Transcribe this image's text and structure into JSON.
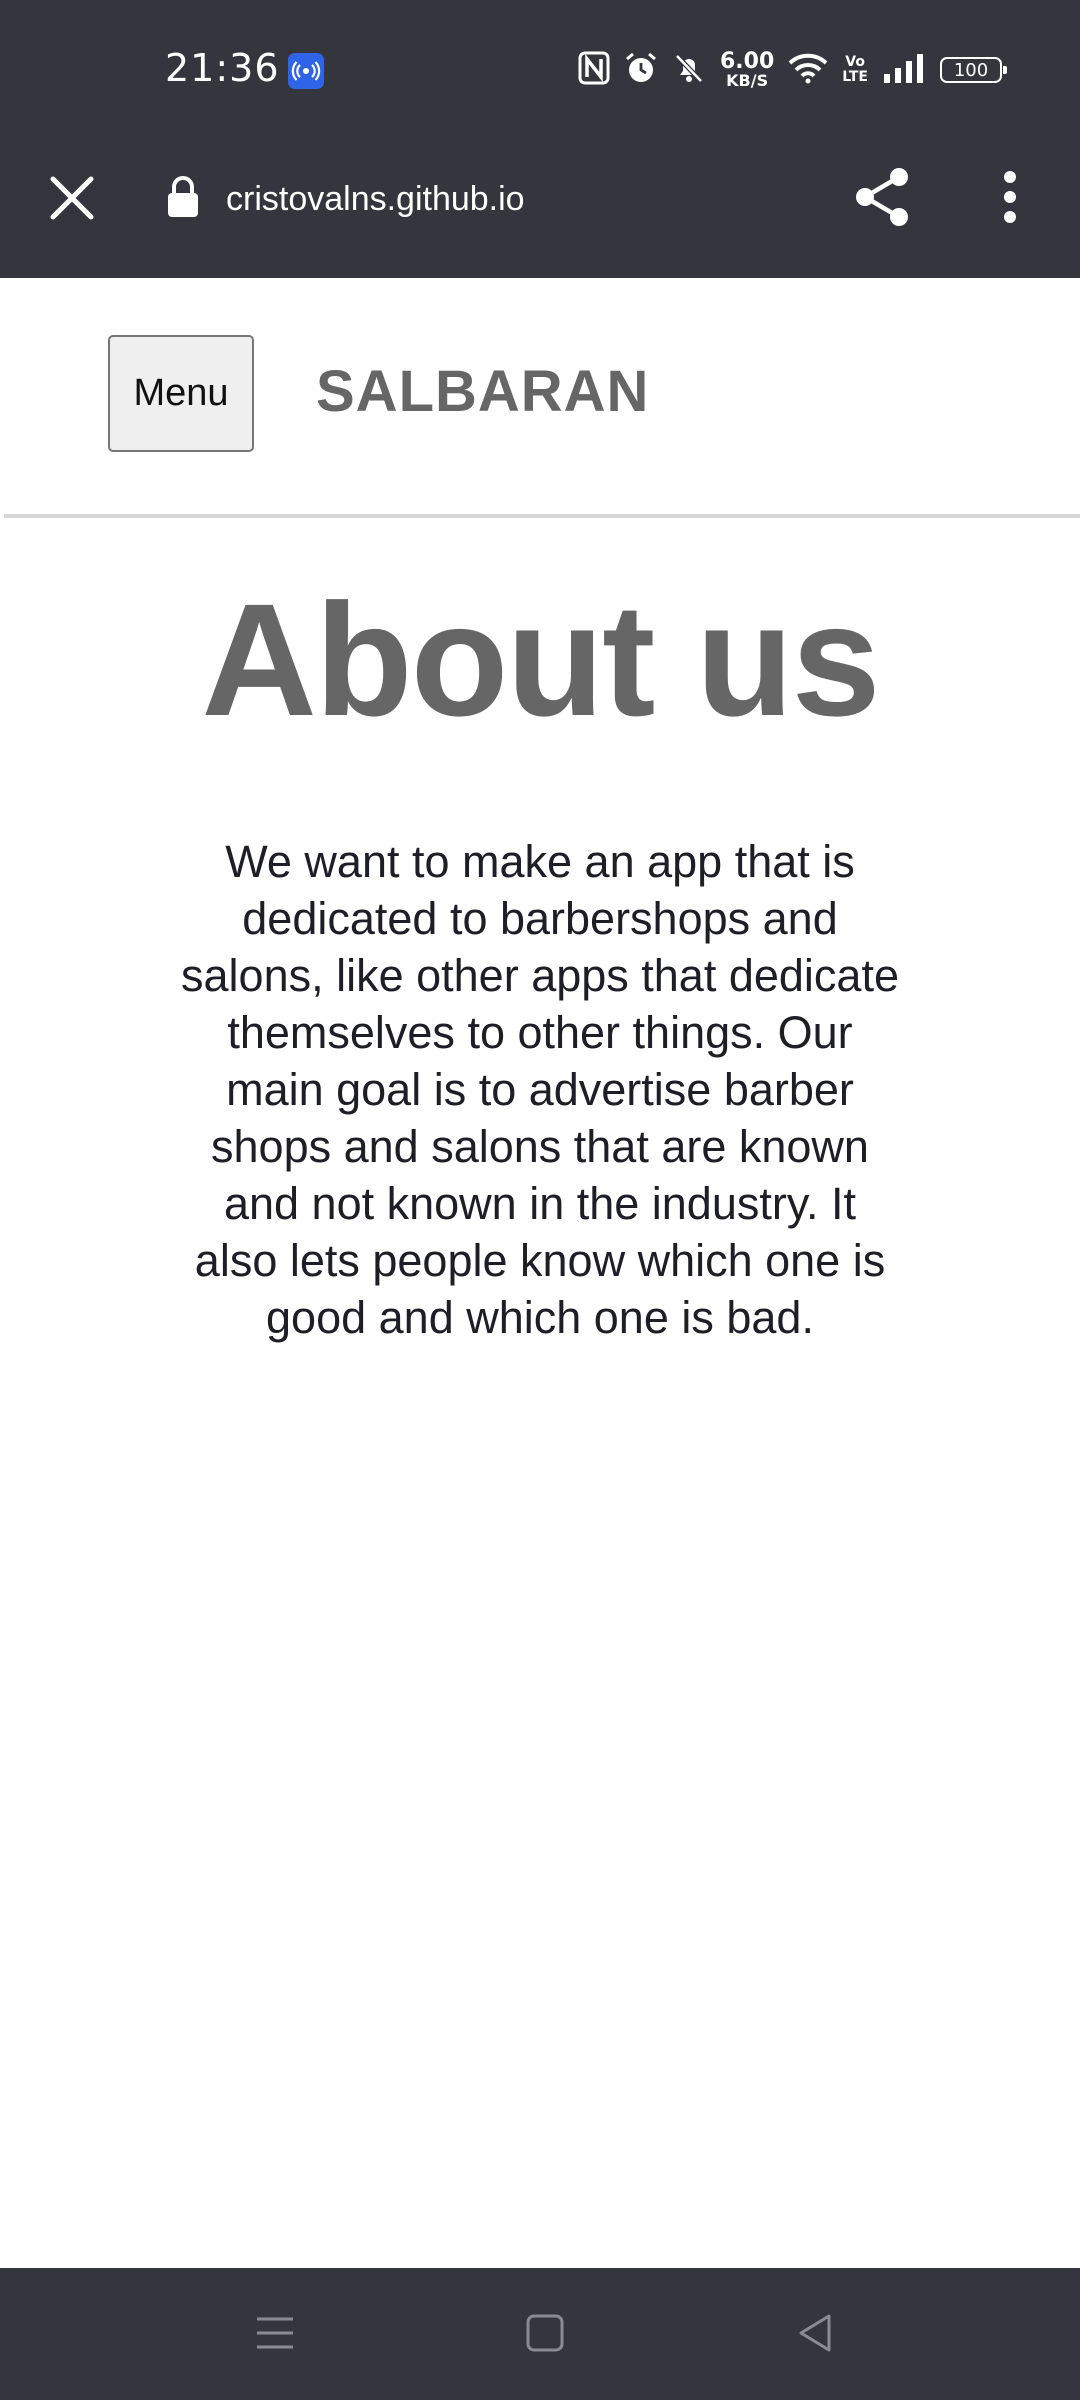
{
  "status_bar": {
    "time": "21:36",
    "network_speed_value": "6.00",
    "network_speed_unit": "KB/S",
    "volte_top": "Vo",
    "volte_bottom": "LTE",
    "battery_level": "100",
    "icons": [
      "hotspot-icon",
      "nfc-icon",
      "alarm-icon",
      "mute-icon",
      "wifi-icon",
      "volte-icon",
      "signal-icon",
      "battery-icon"
    ]
  },
  "browser": {
    "url": "cristovalns.github.io",
    "icons": [
      "close-icon",
      "lock-icon",
      "share-icon",
      "more-vertical-icon"
    ]
  },
  "site_header": {
    "menu_label": "Menu",
    "brand": "SALBARAN"
  },
  "main": {
    "title": "About us",
    "paragraph": "We want to make an app that is dedicated to barbershops and salons, like other apps that dedicate themselves to other things. Our main goal is to advertise barber shops and salons that are known and not known in the industry. It also lets people know which one is good and which one is bad."
  },
  "nav_bar": {
    "icons": [
      "recent-apps-icon",
      "home-icon",
      "back-icon"
    ]
  },
  "colors": {
    "chrome": "#35363d",
    "heading_gray": "#666666",
    "body_text": "#1e1e26",
    "hotspot_blue": "#2f63e8",
    "button_bg": "#efefef"
  }
}
